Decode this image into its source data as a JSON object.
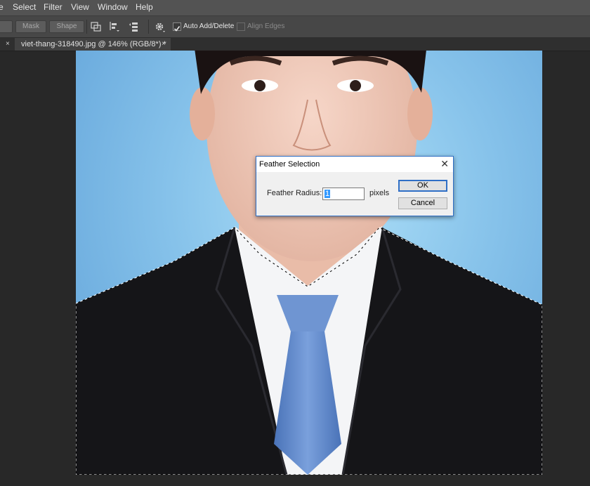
{
  "menu": {
    "items": [
      "e",
      "Select",
      "Filter",
      "View",
      "Window",
      "Help"
    ]
  },
  "options_bar": {
    "partial_button_label": "",
    "mask_label": "Mask",
    "shape_label": "Shape",
    "auto_add_delete_label": "Auto Add/Delete",
    "auto_add_delete_checked": true,
    "align_edges_label": "Align Edges",
    "align_edges_checked": false,
    "icons": [
      "path-operations-icon",
      "path-alignment-icon",
      "path-arrangement-icon",
      "gear-icon"
    ]
  },
  "tabs": {
    "left_close": "×",
    "document_title": "viet-thang-318490.jpg @ 146% (RGB/8*) *",
    "document_close": "×"
  },
  "canvas": {
    "image_description_icon": "portrait-photo",
    "selection": "marching-ants"
  },
  "dialog": {
    "title": "Feather Selection",
    "close": "✕",
    "field_label": "Feather Radius:",
    "field_value": "1",
    "unit": "pixels",
    "ok_label": "OK",
    "cancel_label": "Cancel"
  },
  "colors": {
    "menubar_bg": "#535353",
    "options_bg": "#474747",
    "workspace_bg": "#282828",
    "dialog_accent": "#2f6fc6",
    "selection_highlight": "#3399ff"
  }
}
